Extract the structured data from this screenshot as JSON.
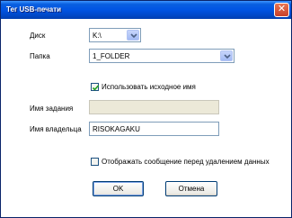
{
  "window": {
    "title": "Тег USB-печати",
    "close_symbol": "✕"
  },
  "fields": {
    "disk": {
      "label": "Диск",
      "value": "K:\\"
    },
    "folder": {
      "label": "Папка",
      "value": "1_FOLDER"
    },
    "use_original_name": {
      "label": "Использовать исходное имя",
      "checked": true
    },
    "job_name": {
      "label": "Имя задания",
      "value": ""
    },
    "owner_name": {
      "label": "Имя владельца",
      "value": "RISOKAGAKU"
    },
    "show_message": {
      "label": "Отображать сообщение перед удалением данных",
      "checked": false
    }
  },
  "buttons": {
    "ok": "OK",
    "cancel": "Отмена"
  },
  "colors": {
    "title_bar": "#0054e3",
    "dialog_face": "#ece9d8",
    "field_border": "#7f9db9"
  }
}
